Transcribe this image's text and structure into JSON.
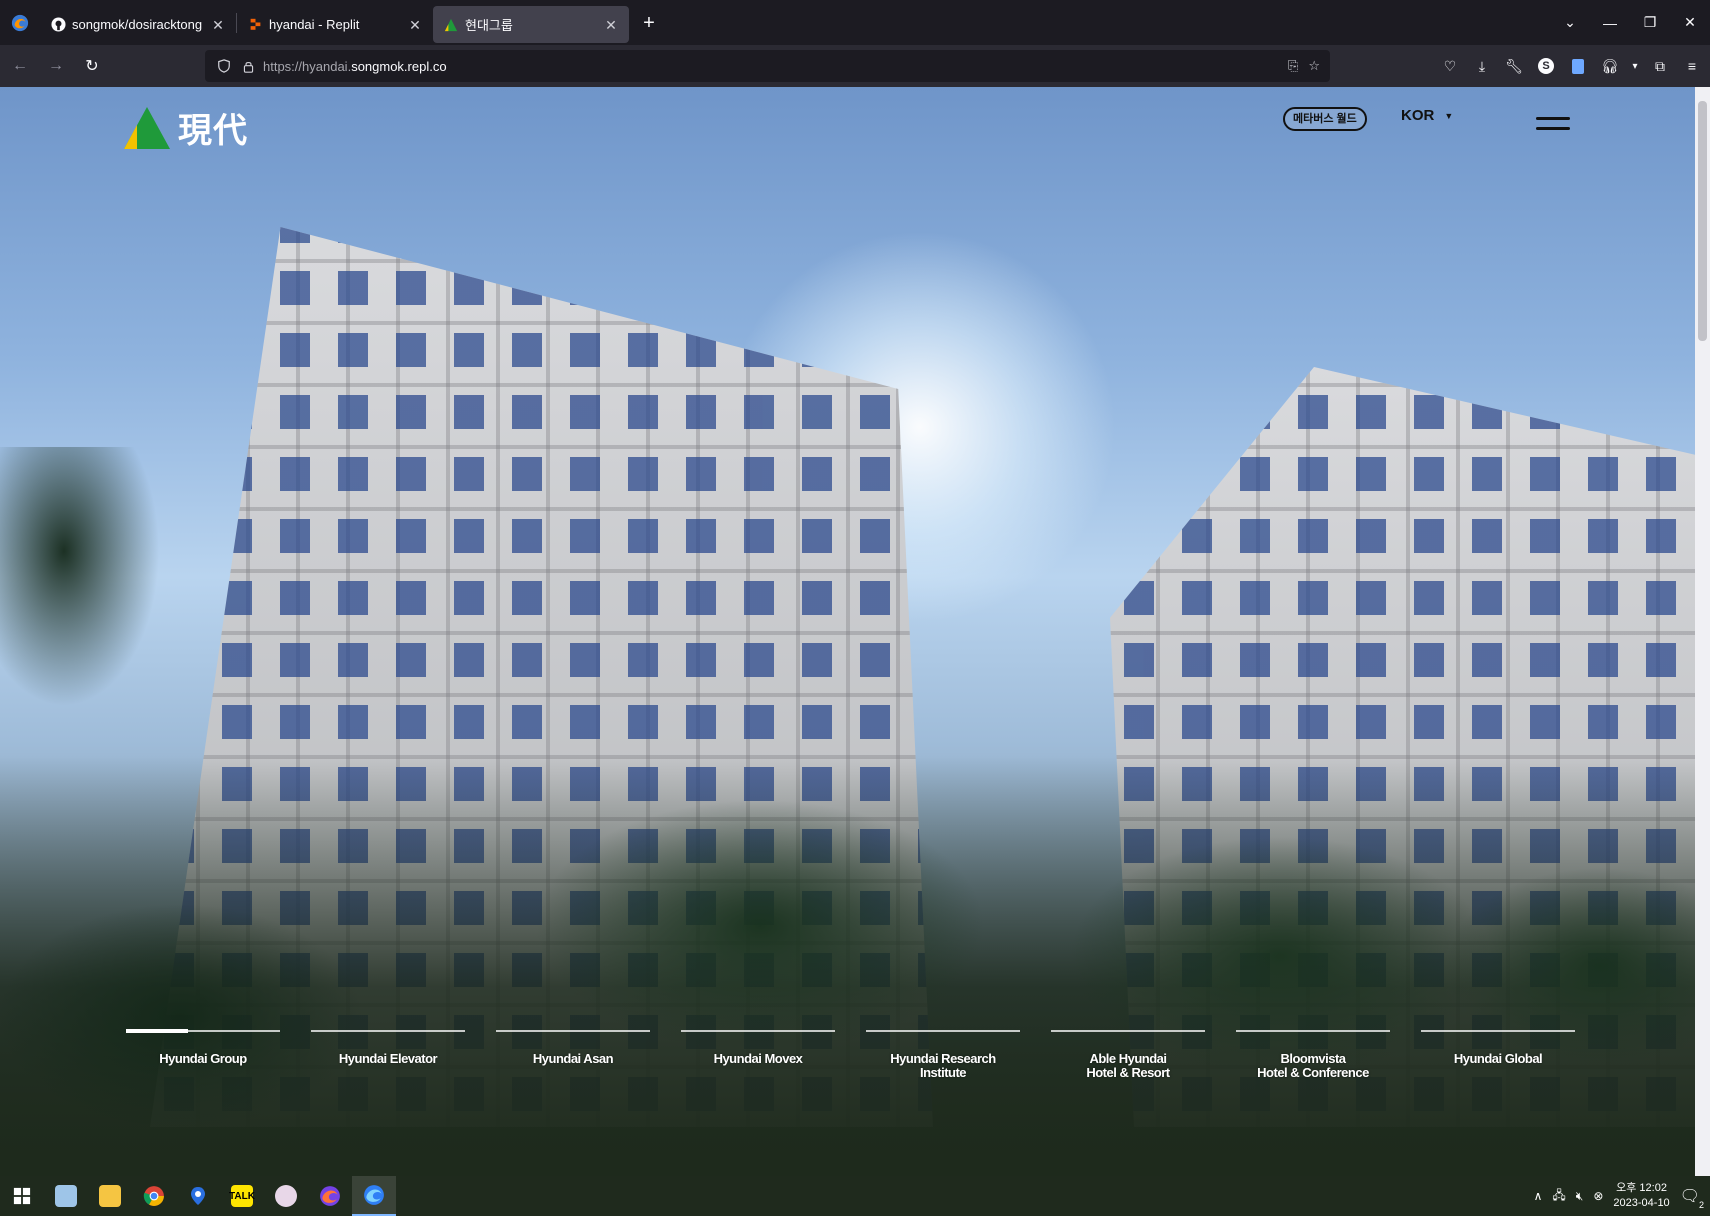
{
  "browser": {
    "tabs": [
      {
        "title": "songmok/dosiracktong",
        "favicon": "github-icon",
        "active": false
      },
      {
        "title": "hyandai - Replit",
        "favicon": "replit-icon",
        "active": false
      },
      {
        "title": "현대그룹",
        "favicon": "hyundai-logo-icon",
        "active": true
      }
    ],
    "url": {
      "protocol": "https://",
      "subdomain": "hyandai.",
      "host": "songmok.repl.co"
    }
  },
  "site": {
    "logo_text": "現代",
    "brand_colors": {
      "green": "#1f9a3a",
      "yellow": "#f2c200"
    },
    "metaverse_button": "메타버스 월드",
    "language": "KOR",
    "affiliates": [
      {
        "label": "Hyundai Group",
        "active": true,
        "progress": 0.4
      },
      {
        "label": "Hyundai Elevator",
        "active": false,
        "progress": 0
      },
      {
        "label": "Hyundai Asan",
        "active": false,
        "progress": 0
      },
      {
        "label": "Hyundai Movex",
        "active": false,
        "progress": 0
      },
      {
        "label": "Hyundai Research Institute",
        "active": false,
        "progress": 0
      },
      {
        "label": "Able Hyundai\nHotel & Resort",
        "active": false,
        "progress": 0
      },
      {
        "label": "Bloomvista\nHotel & Conference",
        "active": false,
        "progress": 0
      },
      {
        "label": "Hyundai Global",
        "active": false,
        "progress": 0
      }
    ]
  },
  "taskbar": {
    "apps": [
      "start-icon",
      "notepad-icon",
      "file-explorer-icon",
      "chrome-icon",
      "maps-icon",
      "kakaotalk-icon",
      "paint-icon",
      "firefox-icon",
      "firefox-dev-icon"
    ],
    "kakao_label": "TALK",
    "clock_time": "오후 12:02",
    "clock_date": "2023-04-10",
    "notification_count": "2"
  }
}
